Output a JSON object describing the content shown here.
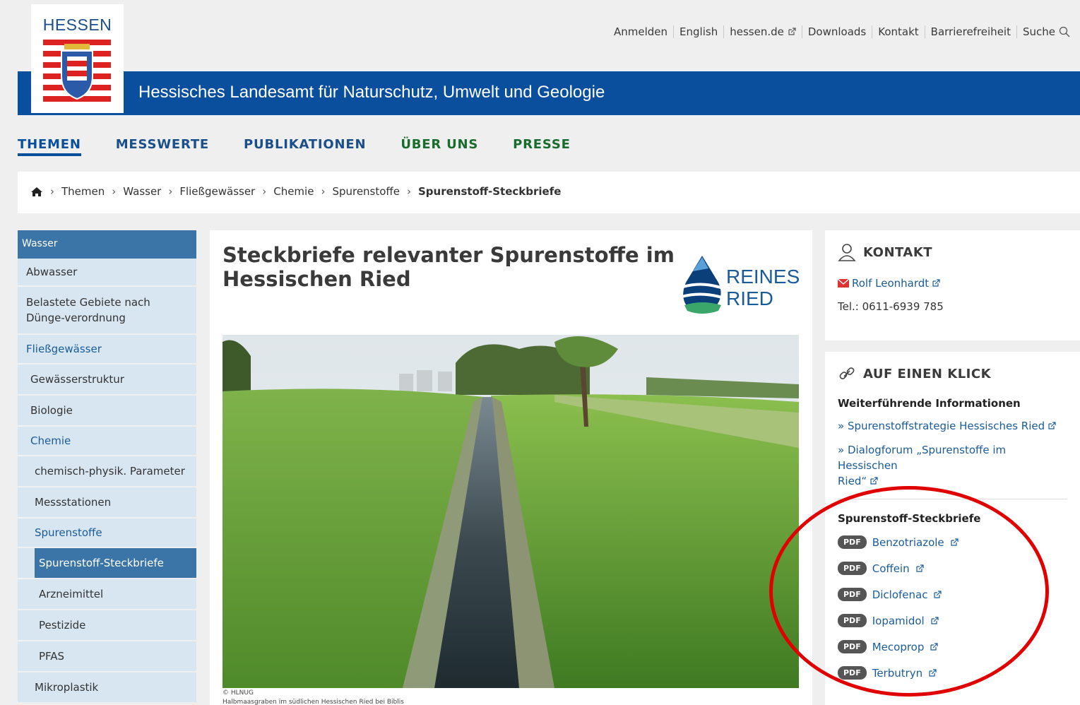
{
  "header": {
    "logo_text": "HESSEN",
    "agency": "Hessisches Landesamt für Naturschutz, Umwelt und Geologie",
    "util_links": [
      "Anmelden",
      "English",
      "hessen.de",
      "Downloads",
      "Kontakt",
      "Barrierefreiheit",
      "Suche"
    ]
  },
  "nav": [
    "THEMEN",
    "MESSWERTE",
    "PUBLIKATIONEN",
    "ÜBER UNS",
    "PRESSE"
  ],
  "breadcrumb": [
    "Themen",
    "Wasser",
    "Fließgewässer",
    "Chemie",
    "Spurenstoffe",
    "Spurenstoff-Steckbriefe"
  ],
  "sidebar": {
    "header": "Wasser",
    "items": [
      "Abwasser",
      "Belastete Gebiete nach Dünge-verordnung",
      "Fließgewässer",
      "Gewässerstruktur",
      "Biologie",
      "Chemie",
      "chemisch-physik. Parameter",
      "Messstationen",
      "Spurenstoffe",
      "Spurenstoff-Steckbriefe",
      "Arzneimittel",
      "Pestizide",
      "PFAS",
      "Mikroplastik"
    ]
  },
  "content": {
    "title": "Steckbriefe relevanter Spurenstoffe im Hessischen Ried",
    "logo_line1": "REINES",
    "logo_line2": "RIED",
    "photo_credit": "© HLNUG",
    "photo_caption": "Halbmaasgraben im südlichen Hessischen Ried bei Biblis"
  },
  "kontakt": {
    "heading": "KONTAKT",
    "name": "Rolf Leonhardt",
    "phone": "Tel.: 0611-6939 785"
  },
  "klick": {
    "heading": "AUF EINEN KLICK",
    "sub1": "Weiterführende Informationen",
    "link1": "» Spurenstoffstrategie Hessisches Ried",
    "link2a": "» Dialogforum „Spurenstoffe im Hessischen",
    "link2b": "Ried“",
    "sub2": "Spurenstoff-Steckbriefe",
    "pdf_label": "PDF",
    "pdfs": [
      "Benzotriazole",
      "Coffein",
      "Diclofenac",
      "Iopamidol",
      "Mecoprop",
      "Terbutryn"
    ]
  },
  "colors": {
    "brand_blue": "#0a4f9e",
    "nav_green": "#1a6b2e",
    "sidebar_bg": "#d8e6f1",
    "sidebar_active": "#3b74a6",
    "annotation_red": "#e00000"
  }
}
